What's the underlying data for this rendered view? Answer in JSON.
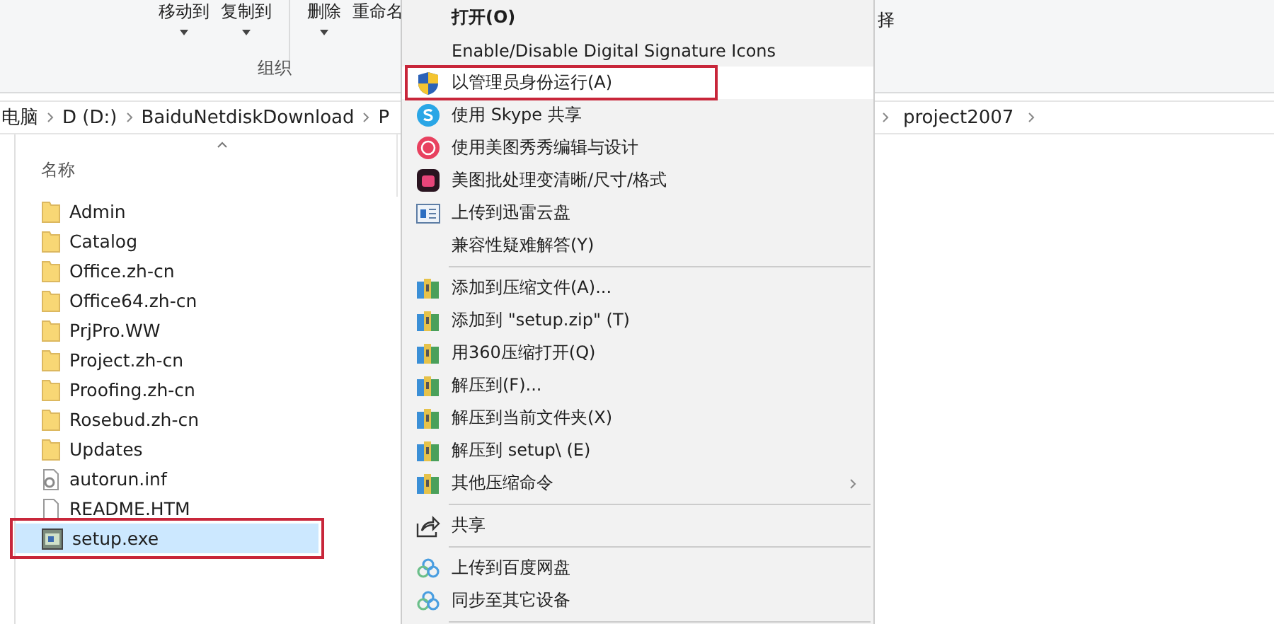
{
  "ribbon": {
    "buttons": [
      {
        "label": "移动到",
        "dropdown": true
      },
      {
        "label": "复制到",
        "dropdown": true
      },
      {
        "label": "删除",
        "dropdown": true
      },
      {
        "label": "重命名",
        "dropdown": false
      }
    ],
    "group_label": "组织",
    "cut_label": "择"
  },
  "breadcrumb": {
    "left": [
      "电脑",
      "D (D:)",
      "BaiduNetdiskDownload",
      "P"
    ],
    "right": [
      "project2007"
    ]
  },
  "file_list": {
    "column": "名称",
    "files": [
      {
        "name": "Admin",
        "kind": "folder",
        "selected": false,
        "highlighted": false
      },
      {
        "name": "Catalog",
        "kind": "folder",
        "selected": false,
        "highlighted": false
      },
      {
        "name": "Office.zh-cn",
        "kind": "folder",
        "selected": false,
        "highlighted": false
      },
      {
        "name": "Office64.zh-cn",
        "kind": "folder",
        "selected": false,
        "highlighted": false
      },
      {
        "name": "PrjPro.WW",
        "kind": "folder",
        "selected": false,
        "highlighted": false
      },
      {
        "name": "Project.zh-cn",
        "kind": "folder",
        "selected": false,
        "highlighted": false
      },
      {
        "name": "Proofing.zh-cn",
        "kind": "folder",
        "selected": false,
        "highlighted": false
      },
      {
        "name": "Rosebud.zh-cn",
        "kind": "folder",
        "selected": false,
        "highlighted": false
      },
      {
        "name": "Updates",
        "kind": "folder",
        "selected": false,
        "highlighted": false
      },
      {
        "name": "autorun.inf",
        "kind": "config",
        "selected": false,
        "highlighted": false
      },
      {
        "name": "README.HTM",
        "kind": "document",
        "selected": false,
        "highlighted": false
      },
      {
        "name": "setup.exe",
        "kind": "program",
        "selected": true,
        "highlighted": true
      }
    ]
  },
  "context_menu": {
    "items": [
      {
        "kind": "plain",
        "label": "打开(O)",
        "default": true,
        "highlighted": false,
        "submenu": false
      },
      {
        "kind": "plain",
        "label": "Enable/Disable Digital Signature Icons",
        "default": false,
        "highlighted": false,
        "submenu": false
      },
      {
        "kind": "shield",
        "label": "以管理员身份运行(A)",
        "default": false,
        "highlighted": true,
        "submenu": false
      },
      {
        "kind": "skype",
        "label": "使用 Skype 共享",
        "default": false,
        "highlighted": false,
        "submenu": false
      },
      {
        "kind": "meitu",
        "label": "使用美图秀秀编辑与设计",
        "default": false,
        "highlighted": false,
        "submenu": false
      },
      {
        "kind": "meitu-batch",
        "label": "美图批处理变清晰/尺寸/格式",
        "default": false,
        "highlighted": false,
        "submenu": false
      },
      {
        "kind": "cloud-card",
        "label": "上传到迅雷云盘",
        "default": false,
        "highlighted": false,
        "submenu": false
      },
      {
        "kind": "plain",
        "label": "兼容性疑难解答(Y)",
        "default": false,
        "highlighted": false,
        "submenu": false
      },
      {
        "kind": "separator"
      },
      {
        "kind": "archive",
        "label": "添加到压缩文件(A)...",
        "default": false,
        "highlighted": false,
        "submenu": false
      },
      {
        "kind": "archive",
        "label": "添加到 \"setup.zip\" (T)",
        "default": false,
        "highlighted": false,
        "submenu": false
      },
      {
        "kind": "archive",
        "label": "用360压缩打开(Q)",
        "default": false,
        "highlighted": false,
        "submenu": false
      },
      {
        "kind": "archive",
        "label": "解压到(F)...",
        "default": false,
        "highlighted": false,
        "submenu": false
      },
      {
        "kind": "archive",
        "label": "解压到当前文件夹(X)",
        "default": false,
        "highlighted": false,
        "submenu": false
      },
      {
        "kind": "archive",
        "label": "解压到 setup\\ (E)",
        "default": false,
        "highlighted": false,
        "submenu": false
      },
      {
        "kind": "archive",
        "label": "其他压缩命令",
        "default": false,
        "highlighted": false,
        "submenu": true
      },
      {
        "kind": "separator"
      },
      {
        "kind": "share",
        "label": "共享",
        "default": false,
        "highlighted": false,
        "submenu": false
      },
      {
        "kind": "separator"
      },
      {
        "kind": "baidu",
        "label": "上传到百度网盘",
        "default": false,
        "highlighted": false,
        "submenu": false
      },
      {
        "kind": "baidu",
        "label": "同步至其它设备",
        "default": false,
        "highlighted": false,
        "submenu": false
      },
      {
        "kind": "separator"
      }
    ]
  }
}
